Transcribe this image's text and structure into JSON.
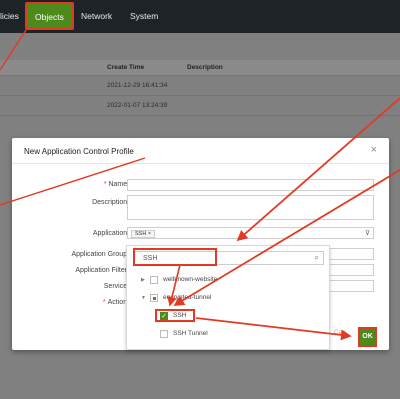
{
  "nav": {
    "items": [
      "licies",
      "Objects",
      "Network",
      "System"
    ]
  },
  "bg_table": {
    "headers": [
      "Create Time",
      "Description"
    ],
    "rows": [
      {
        "time": "2021-12-29 16:41:34"
      },
      {
        "time": "2022-01-07 13:24:39"
      }
    ]
  },
  "modal": {
    "title": "New Application Control Profile",
    "close": "×",
    "labels": {
      "name": "Name :",
      "description": "Description :",
      "application": "Application :",
      "application_group": "Application Group :",
      "application_filter": "Application Filter :",
      "service": "Service :",
      "action": "Action :"
    },
    "application_tag": "SSH ×",
    "buttons": {
      "cancel": "Can",
      "ok": "OK"
    }
  },
  "dropdown": {
    "search_value": "SSH",
    "tree": [
      {
        "label": "wellknown-website",
        "level": 0,
        "expanded": false,
        "state": "unchecked"
      },
      {
        "label": "encrypted-tunnel",
        "level": 0,
        "expanded": true,
        "state": "partial"
      },
      {
        "label": "SSH",
        "level": 1,
        "state": "checked"
      },
      {
        "label": "SSH Tunnel",
        "level": 1,
        "state": "unchecked"
      }
    ]
  },
  "colors": {
    "accent_green": "#4c8a1c",
    "annotation_red": "#e23a22",
    "nav_bg": "#1e2328"
  }
}
